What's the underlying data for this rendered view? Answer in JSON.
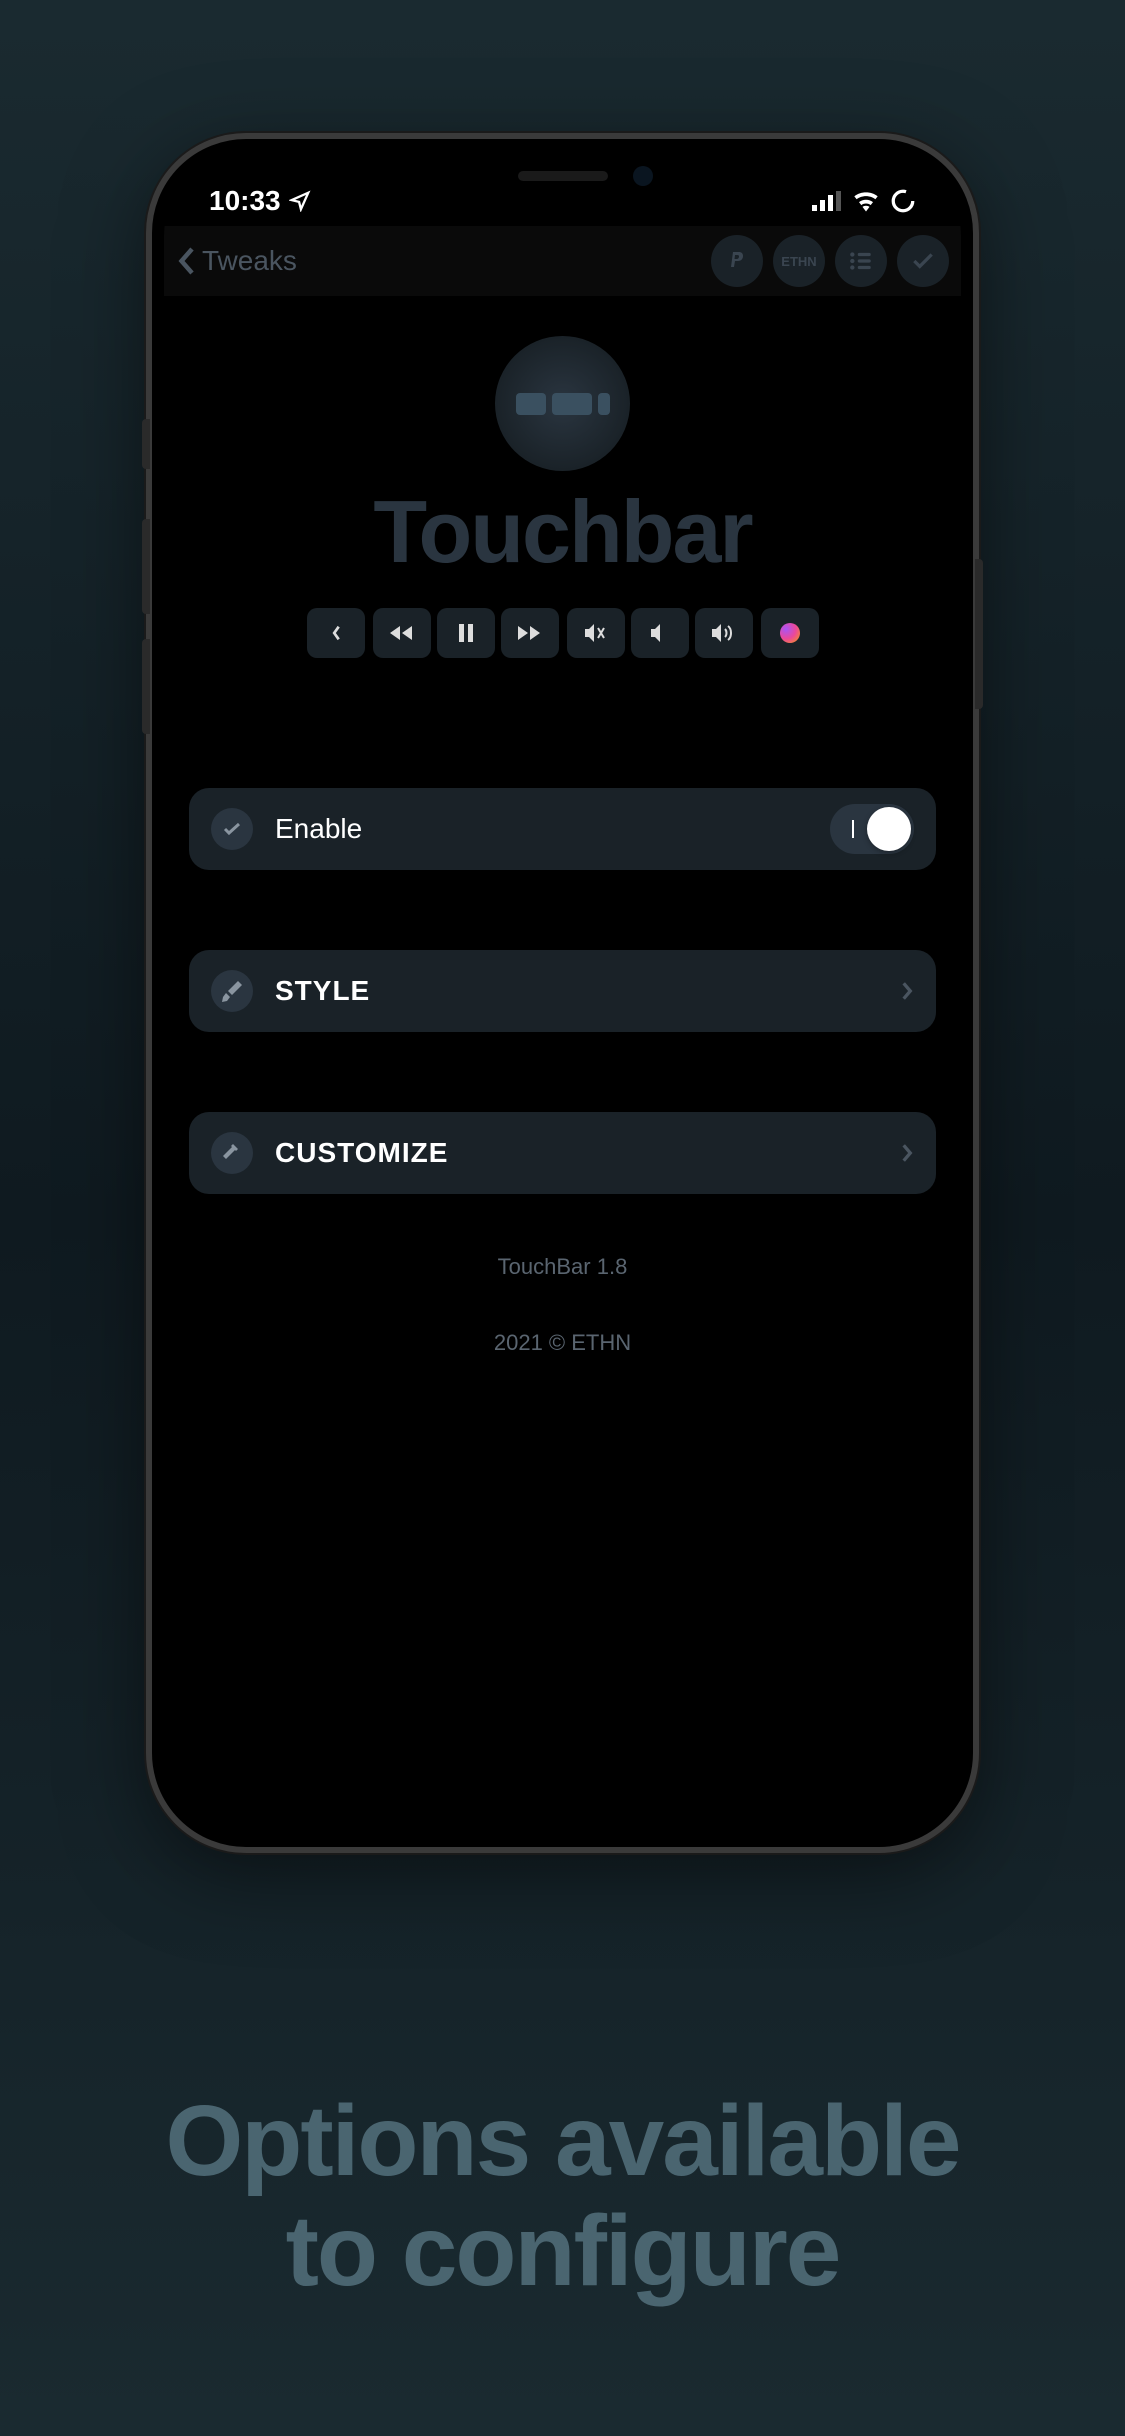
{
  "status": {
    "time": "10:33"
  },
  "nav": {
    "back_label": "Tweaks",
    "badge": "ETHN"
  },
  "app": {
    "title": "Touchbar"
  },
  "rows": {
    "enable": {
      "label": "Enable"
    },
    "style": {
      "label": "STYLE"
    },
    "customize": {
      "label": "CUSTOMIZE"
    }
  },
  "footer": {
    "version": "TouchBar 1.8",
    "copyright": "2021 © ETHN"
  },
  "caption": {
    "line1": "Options available",
    "line2": "to configure"
  }
}
